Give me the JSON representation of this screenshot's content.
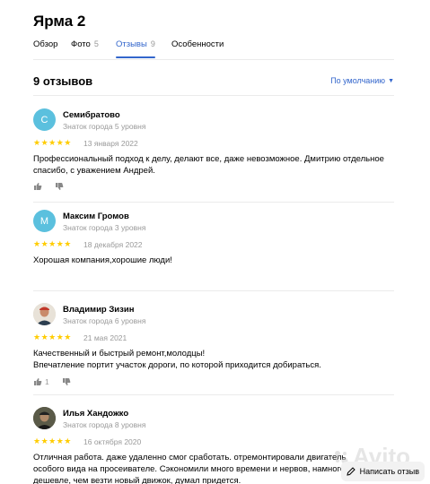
{
  "title": "Ярма 2",
  "tabs": [
    {
      "label": "Обзор",
      "count": ""
    },
    {
      "label": "Фото",
      "count": "5"
    },
    {
      "label": "Отзывы",
      "count": "9"
    },
    {
      "label": "Особенности",
      "count": ""
    }
  ],
  "reviews_header": {
    "count_title": "9 отзывов",
    "sort_label": "По умолчанию"
  },
  "reviews": [
    {
      "initial": "С",
      "avatar_color": "#5bc0de",
      "author": "Семибратово",
      "level": "Знаток города 5 уровня",
      "stars": "★★★★★",
      "date": "13 января 2022",
      "text": "Профессиональный подход к делу, делают все, даже невозможное. Дмитрию отдельное спасибо, с уважением Андрей.",
      "likes": ""
    },
    {
      "initial": "М",
      "avatar_color": "#5bc0de",
      "author": "Максим Громов",
      "level": "Знаток города 3 уровня",
      "stars": "★★★★★",
      "date": "18 декабря 2022",
      "text": "Хорошая компания,хорошие люди!",
      "likes": ""
    },
    {
      "initial": "",
      "avatar_color": "#c97a5a",
      "author": "Владимир Зизин",
      "level": "Знаток города 6 уровня",
      "stars": "★★★★★",
      "date": "21 мая 2021",
      "text": "Качественный и быстрый ремонт,молодцы!\nВпечатление портит участок дороги, по которой приходится добираться.",
      "likes": "1"
    },
    {
      "initial": "",
      "avatar_color": "#4a4a3a",
      "author": "Илья Хандожко",
      "level": "Знаток города 8 уровня",
      "stars": "★★★★★",
      "date": "16 октября 2020",
      "text": "Отличная работа. даже удаленно смог сработать. отремонтировали двигатель особого вида на просеивателе. Сэкономили много времени и нервов, намного дешевле, чем везти новый движок, думал придется.",
      "likes": ""
    }
  ],
  "watermark": "Avito",
  "write_review_label": "Написать отзыв"
}
